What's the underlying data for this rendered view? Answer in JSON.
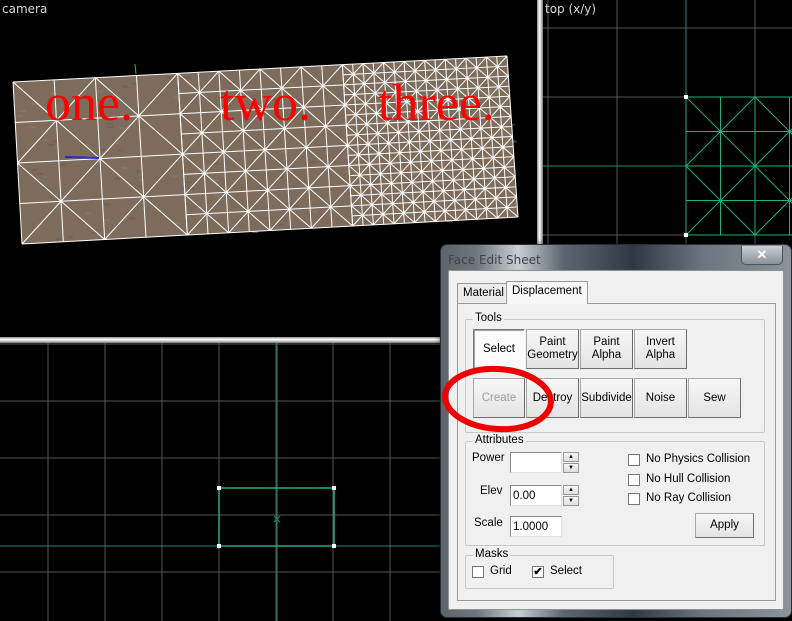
{
  "viewports": {
    "camera": {
      "label": "camera",
      "overlay_text": [
        "one.",
        "two.",
        "three."
      ]
    },
    "top": {
      "label": "top (x/y)"
    },
    "side": {
      "label": ""
    }
  },
  "colors": {
    "grid": "#555555",
    "axis": "#1a8a7a",
    "selection": "#1fae85",
    "mesh": "#ffffff",
    "annotation": "#ff0000",
    "terrain": "#7d6c5c"
  },
  "dialog": {
    "title": "Face Edit Sheet",
    "close_label": "✕",
    "tabs": [
      {
        "label": "Material",
        "active": false
      },
      {
        "label": "Displacement",
        "active": true
      }
    ],
    "tools": {
      "group_label": "Tools",
      "buttons": [
        {
          "label": "Select",
          "state": "pressed"
        },
        {
          "label": "Paint Geometry",
          "state": "normal"
        },
        {
          "label": "Paint Alpha",
          "state": "normal"
        },
        {
          "label": "Invert Alpha",
          "state": "normal"
        },
        {
          "label": "Create",
          "state": "disabled"
        },
        {
          "label": "Destroy",
          "state": "normal"
        },
        {
          "label": "Subdivide",
          "state": "normal"
        },
        {
          "label": "Noise",
          "state": "normal"
        },
        {
          "label": "Sew",
          "state": "normal"
        }
      ]
    },
    "attributes": {
      "group_label": "Attributes",
      "power_label": "Power",
      "power_value": "",
      "elev_label": "Elev",
      "elev_value": "0.00",
      "scale_label": "Scale",
      "scale_value": "1.0000",
      "checkboxes": [
        {
          "label": "No Physics Collision",
          "checked": false
        },
        {
          "label": "No Hull Collision",
          "checked": false
        },
        {
          "label": "No Ray Collision",
          "checked": false
        }
      ],
      "apply_label": "Apply"
    },
    "masks": {
      "group_label": "Masks",
      "grid_label": "Grid",
      "grid_checked": false,
      "select_label": "Select",
      "select_checked": true
    }
  }
}
